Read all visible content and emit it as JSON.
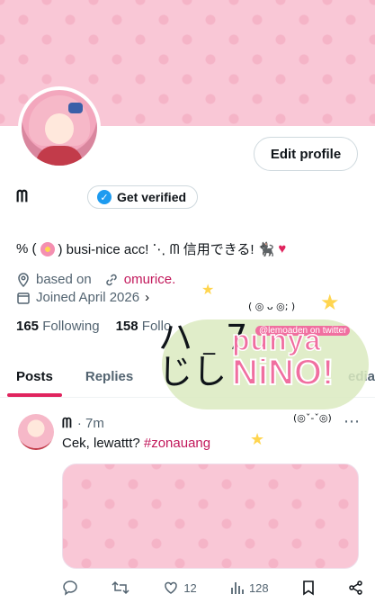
{
  "profile": {
    "name": "ᗰ",
    "edit_label": "Edit profile",
    "verify_label": "Get verified",
    "bio_prefix": "% (",
    "bio_main": ") busi-nice acc! ⋱ ᗰ 信用できる! 🐈‍⬛",
    "bio_heart": "♥",
    "location_label": "based on",
    "link_text": "omurice.",
    "joined": "Joined April 2026"
  },
  "stats": {
    "following_count": "165",
    "following_label": "Following",
    "followers_count": "158",
    "followers_label": "Follo"
  },
  "tabs": [
    "Posts",
    "Replies",
    "edia"
  ],
  "post": {
    "author": "ᗰ",
    "time": "· 7m",
    "text": "Cek, lewattt? ",
    "hashtag": "#zonauang",
    "more": "⋯",
    "likes": "12",
    "views": "128"
  },
  "sticker": {
    "handle": "@lemoaden on twitter",
    "line1": "punya",
    "line2": "NiNO!",
    "face": "ハ _ 7\nじし",
    "kaomoji_top": "( ◎ ᴗ ◎; )",
    "kaomoji_side": "(◎ˇ-ˇ◎)"
  },
  "colors": {
    "accent": "#e0245e",
    "link": "#c2185b",
    "verified": "#1d9bf0",
    "banner": "#f9c7d6"
  }
}
